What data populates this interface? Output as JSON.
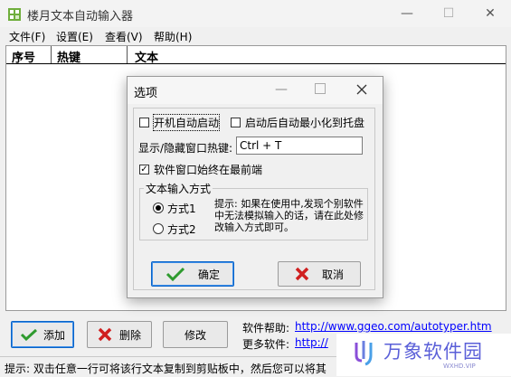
{
  "window": {
    "title": "楼月文本自动输入器",
    "minimize": "—",
    "maximize": "☐",
    "close": "✕"
  },
  "menu": [
    "文件(F)",
    "设置(E)",
    "查看(V)",
    "帮助(H)"
  ],
  "table": {
    "columns": [
      "序号",
      "热键",
      "文本"
    ]
  },
  "buttons": {
    "add": "添加",
    "delete": "删除",
    "edit": "修改"
  },
  "help": {
    "help_label": "软件帮助:",
    "help_url": "http://www.ggeo.com/autotyper.htm",
    "more_label": "更多软件:",
    "more_url": "http://"
  },
  "statusbar": {
    "text": "提示: 双击任意一行可将该行文本复制到剪贴板中，然后您可以将其"
  },
  "dialog": {
    "title": "选项",
    "autostart_label": "开机自动启动",
    "autostart_checked": false,
    "minimize_tray_label": "启动后自动最小化到托盘",
    "minimize_tray_checked": false,
    "hotkey_label": "显示/隐藏窗口热键:",
    "hotkey_value": "Ctrl + T",
    "topmost_label": "软件窗口始终在最前端",
    "topmost_checked": true,
    "group_title": "文本输入方式",
    "mode1_label": "方式1",
    "mode2_label": "方式2",
    "selected_mode": 1,
    "hint": "提示: 如果在使用中,发现个别软件中无法模拟输入的话，请在此处修改输入方式即可。",
    "ok_label": "确定",
    "cancel_label": "取消"
  },
  "watermark": {
    "brand": "万象软件园",
    "domain": "WXHD.VIP"
  },
  "colors": {
    "accent": "#0a64c8",
    "link": "#0000ff",
    "ok_check": "#2e9a2e",
    "delete_x": "#d02020"
  }
}
